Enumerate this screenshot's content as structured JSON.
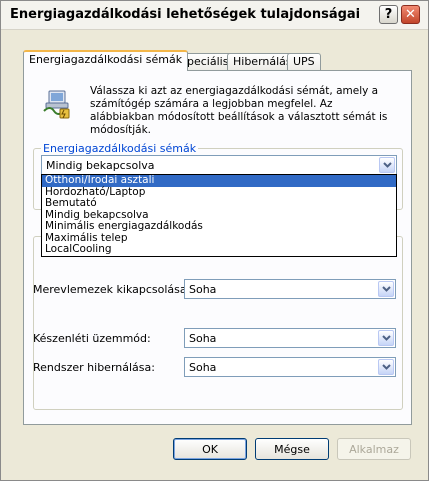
{
  "window": {
    "title": "Energiagazdálkodási lehetőségek tulajdonságai",
    "help_glyph": "?",
    "close_glyph": "✕"
  },
  "tabs": [
    {
      "label": "Energiagazdálkodási sémák",
      "active": true
    },
    {
      "label": "Speciális"
    },
    {
      "label": "Hibernálás"
    },
    {
      "label": "UPS"
    }
  ],
  "intro": {
    "text": "Válassza ki azt az energiagazdálkodási sémát, amely a számítógép számára a legjobban megfelel. Az alábbiakban módosított beállítások a választott sémát is módosítják.",
    "icon": "power-scheme-icon"
  },
  "scheme_group": {
    "title": "Energiagazdálkodási sémák",
    "selected": "Mindig bekapcsolva",
    "options": [
      "Otthoni/Irodai asztali",
      "Hordozható/Laptop",
      "Bemutató",
      "Mindig bekapcsolva",
      "Minimális energiagazdálkodás",
      "Maximális telep",
      "LocalCooling"
    ],
    "highlighted_index": 0
  },
  "settings": [
    {
      "label": "Merevlemezek kikapcsolása:",
      "value": "Soha"
    },
    {
      "label": "Készenléti üzemmód:",
      "value": "Soha"
    },
    {
      "label": "Rendszer hibernálása:",
      "value": "Soha"
    }
  ],
  "buttons": {
    "ok": "OK",
    "cancel": "Mégse",
    "apply": "Alkalmaz"
  },
  "colors": {
    "accent": "#316ac5",
    "group_title": "#0046d5",
    "close": "#c2452a"
  }
}
